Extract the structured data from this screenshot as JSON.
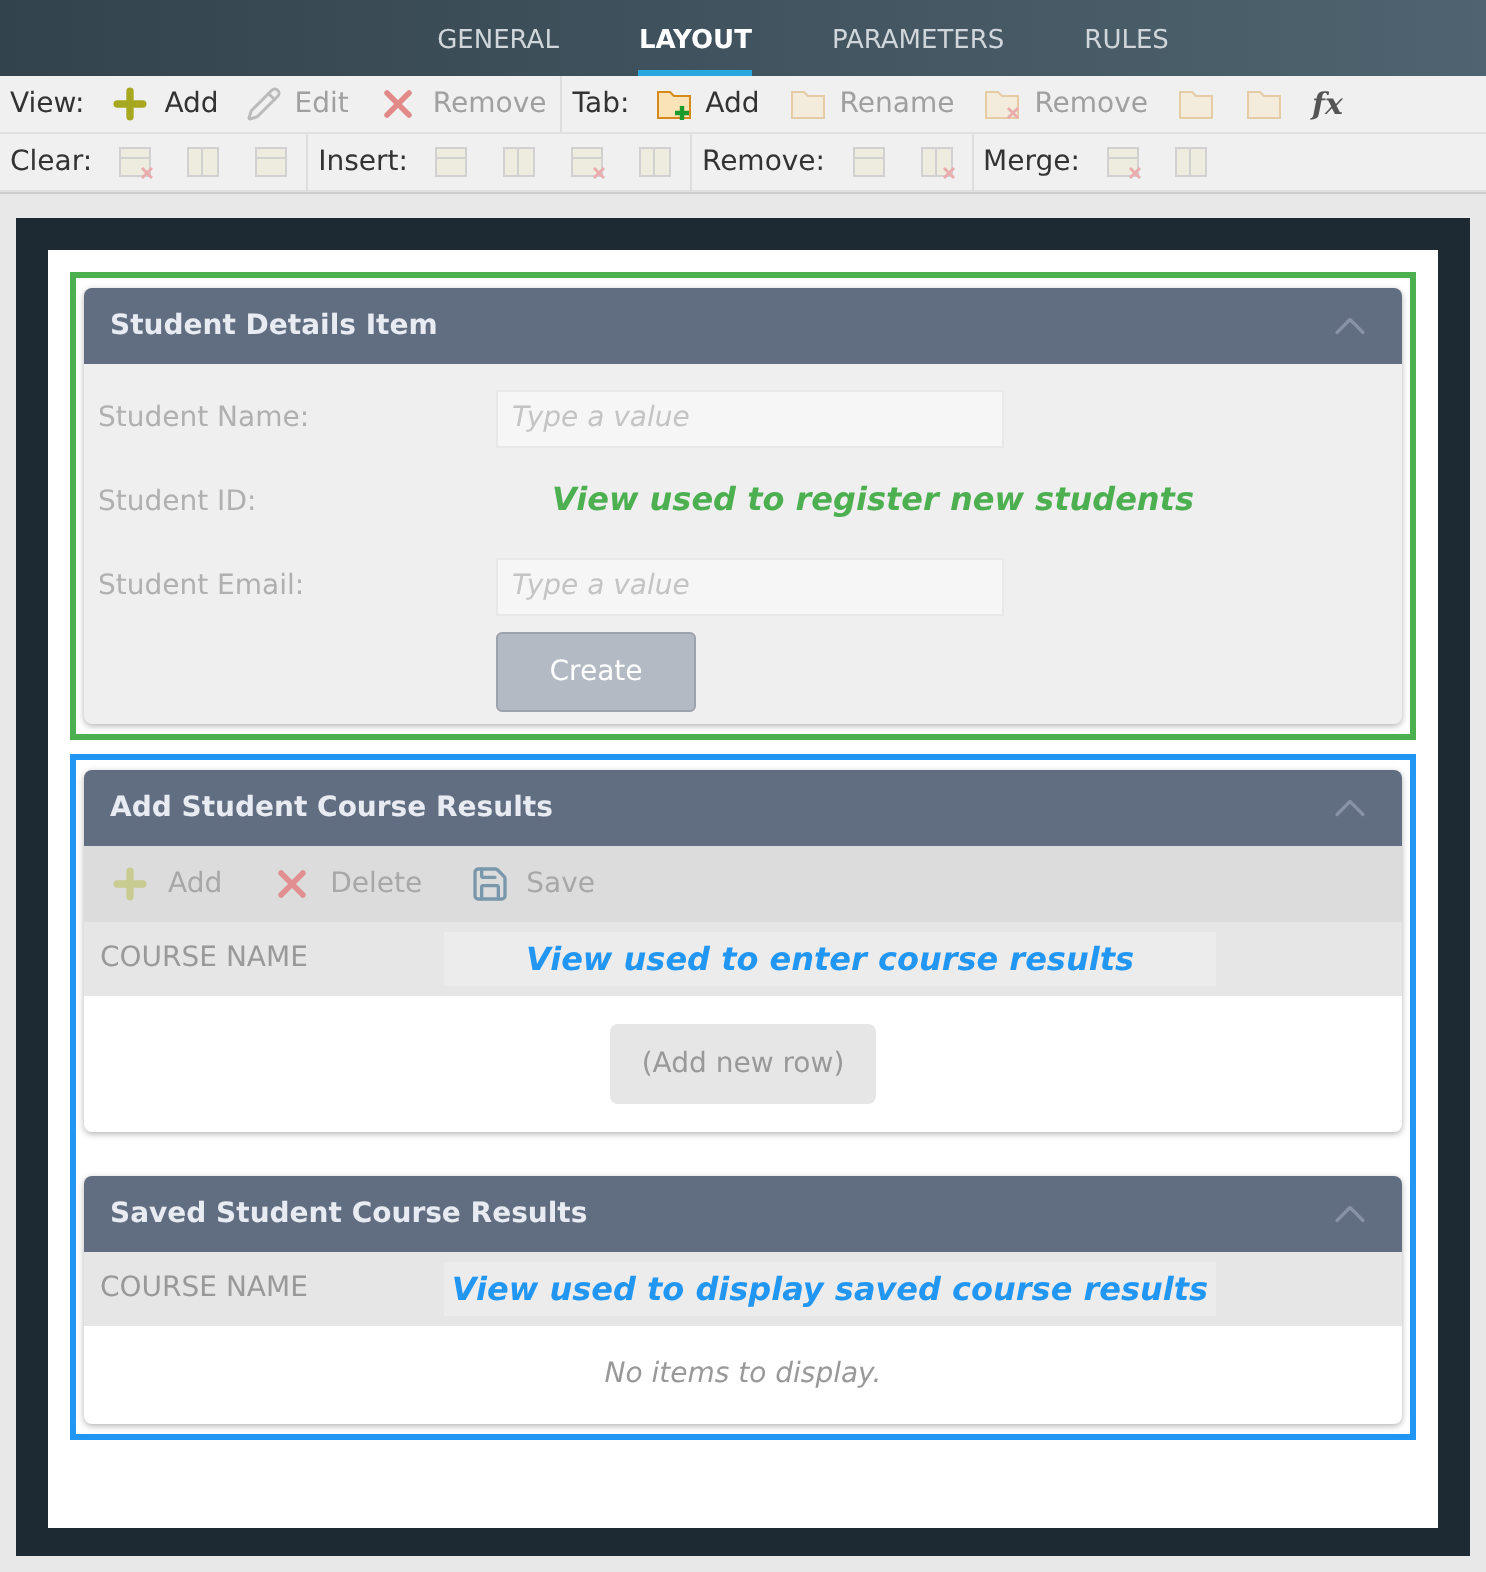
{
  "tabs": [
    {
      "label": "GENERAL",
      "selected": false
    },
    {
      "label": "LAYOUT",
      "selected": true
    },
    {
      "label": "PARAMETERS",
      "selected": false
    },
    {
      "label": "RULES",
      "selected": false
    }
  ],
  "toolbar": [
    [
      {
        "label": "View:",
        "buttons": [
          {
            "text": "Add",
            "disabled": false
          },
          {
            "text": "Edit",
            "disabled": true
          },
          {
            "text": "Remove",
            "disabled": true
          }
        ]
      },
      {
        "label": "Tab:",
        "buttons": [
          {
            "text": "Add",
            "disabled": false
          },
          {
            "text": "Rename",
            "disabled": true
          },
          {
            "text": "Remove",
            "disabled": true
          },
          {
            "disabled": true
          },
          {
            "disabled": true
          },
          {
            "symbol": "fx",
            "disabled": false
          }
        ]
      }
    ],
    [
      {
        "label": "Clear:",
        "buttons": [
          {
            "disabled": true
          },
          {
            "disabled": true
          },
          {
            "disabled": true
          }
        ]
      },
      {
        "label": "Insert:",
        "buttons": [
          {
            "disabled": true
          },
          {
            "disabled": true
          },
          {
            "disabled": true
          },
          {
            "disabled": true
          }
        ]
      },
      {
        "label": "Remove:",
        "buttons": [
          {
            "disabled": true
          },
          {
            "disabled": true
          }
        ]
      },
      {
        "label": "Merge:",
        "buttons": [
          {
            "disabled": true
          },
          {
            "disabled": true
          }
        ]
      }
    ]
  ],
  "groups": [
    {
      "color": "#4caf50",
      "annotation": "View used to register new students",
      "panels": [
        {
          "kind": "form",
          "title": "Student Details Item",
          "fields": [
            {
              "label": "Student Name:",
              "placeholder": "Type a value"
            },
            {
              "label": "Student ID:"
            },
            {
              "label": "Student Email:",
              "placeholder": "Type a value"
            }
          ],
          "button": "Create"
        }
      ]
    },
    {
      "color": "#2196f3",
      "annotation": "View used to enter course results",
      "panels": [
        {
          "kind": "list",
          "title": "Add Student Course Results",
          "actions": [
            "Add",
            "Delete",
            "Save"
          ],
          "column_1": "COURSE NAME",
          "add_row": "(Add new row)"
        },
        {
          "kind": "list",
          "title": "Saved Student Course Results",
          "column_1": "COURSE NAME",
          "empty": "No items to display.",
          "annotation": "View used to display saved course results"
        }
      ]
    }
  ]
}
